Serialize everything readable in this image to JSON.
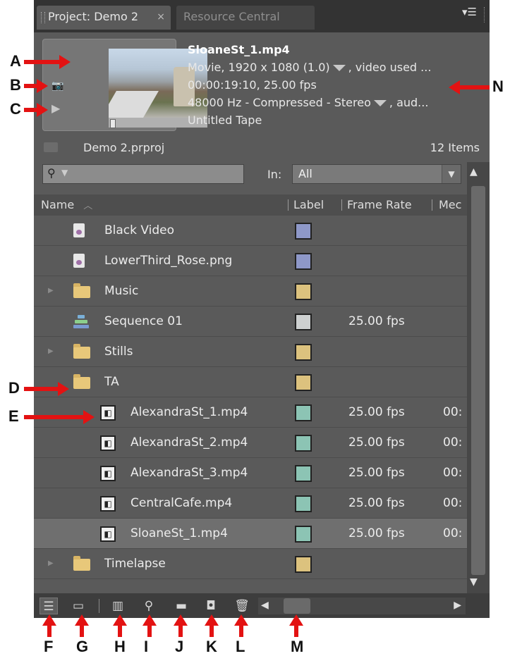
{
  "tabs": {
    "active": "Project: Demo 2",
    "active_close": "×",
    "inactive": "Resource Central",
    "menu_icon": "panel-menu-icon"
  },
  "clip_info": {
    "name": "SloaneSt_1.mp4",
    "line1_a": "Movie, 1920 x 1080 (1.0)",
    "line1_b": ", video used ...",
    "line2": "00:00:19:10, 25.00 fps",
    "line3_a": "48000 Hz - Compressed - Stereo",
    "line3_b": ", aud...",
    "line4": "Untitled Tape"
  },
  "project": {
    "name": "Demo 2.prproj",
    "count": "12 Items"
  },
  "filter": {
    "in_label": "In:",
    "in_value": "All"
  },
  "columns": {
    "name": "Name",
    "label": "Label",
    "frame_rate": "Frame Rate",
    "media": "Mec"
  },
  "rows": [
    {
      "name": "Black Video",
      "type": "still",
      "indent": 0,
      "expandable": false,
      "label_color": "#8e98c8",
      "fps": "",
      "media": ""
    },
    {
      "name": "LowerThird_Rose.png",
      "type": "still",
      "indent": 0,
      "expandable": false,
      "label_color": "#8e98c8",
      "fps": "",
      "media": ""
    },
    {
      "name": "Music",
      "type": "bin",
      "indent": 0,
      "expandable": true,
      "label_color": "#dcc27e",
      "fps": "",
      "media": ""
    },
    {
      "name": "Sequence 01",
      "type": "sequence",
      "indent": 0,
      "expandable": false,
      "label_color": "#cdd0d0",
      "fps": "25.00 fps",
      "media": ""
    },
    {
      "name": "Stills",
      "type": "bin",
      "indent": 0,
      "expandable": true,
      "label_color": "#dcc27e",
      "fps": "",
      "media": ""
    },
    {
      "name": "TA",
      "type": "bin",
      "indent": 0,
      "expandable": false,
      "label_color": "#dcc27e",
      "fps": "",
      "media": ""
    },
    {
      "name": "AlexandraSt_1.mp4",
      "type": "clip",
      "indent": 1,
      "expandable": false,
      "label_color": "#8cc4b4",
      "fps": "25.00 fps",
      "media": "00:"
    },
    {
      "name": "AlexandraSt_2.mp4",
      "type": "clip",
      "indent": 1,
      "expandable": false,
      "label_color": "#8cc4b4",
      "fps": "25.00 fps",
      "media": "00:"
    },
    {
      "name": "AlexandraSt_3.mp4",
      "type": "clip",
      "indent": 1,
      "expandable": false,
      "label_color": "#8cc4b4",
      "fps": "25.00 fps",
      "media": "00:"
    },
    {
      "name": "CentralCafe.mp4",
      "type": "clip",
      "indent": 1,
      "expandable": false,
      "label_color": "#8cc4b4",
      "fps": "25.00 fps",
      "media": "00:"
    },
    {
      "name": "SloaneSt_1.mp4",
      "type": "clip",
      "indent": 1,
      "expandable": false,
      "label_color": "#8cc4b4",
      "fps": "25.00 fps",
      "media": "00:",
      "selected": true
    },
    {
      "name": "Timelapse",
      "type": "bin",
      "indent": 0,
      "expandable": true,
      "label_color": "#dcc27e",
      "fps": "",
      "media": ""
    }
  ],
  "bottom_icons": [
    {
      "name": "list-view-icon",
      "glyph": "☰",
      "active": true
    },
    {
      "name": "icon-view-icon",
      "glyph": "▭",
      "active": false
    },
    {
      "name": "automate-to-sequence-icon",
      "glyph": "▥",
      "active": false
    },
    {
      "name": "find-icon",
      "glyph": "⚲",
      "active": false
    },
    {
      "name": "new-bin-icon",
      "glyph": "▬",
      "active": false
    },
    {
      "name": "new-item-icon",
      "glyph": "◘",
      "active": false
    },
    {
      "name": "clear-icon",
      "glyph": "🗑",
      "active": false
    }
  ],
  "callouts": {
    "A": "A",
    "B": "B",
    "C": "C",
    "D": "D",
    "E": "E",
    "F": "F",
    "G": "G",
    "H": "H",
    "I": "I",
    "J": "J",
    "K": "K",
    "L": "L",
    "M": "M",
    "N": "N"
  },
  "colors": {
    "annotation_arrow": "#e31212",
    "panel_bg": "#5a5a5a",
    "selected_row": "#6f6f6f"
  }
}
